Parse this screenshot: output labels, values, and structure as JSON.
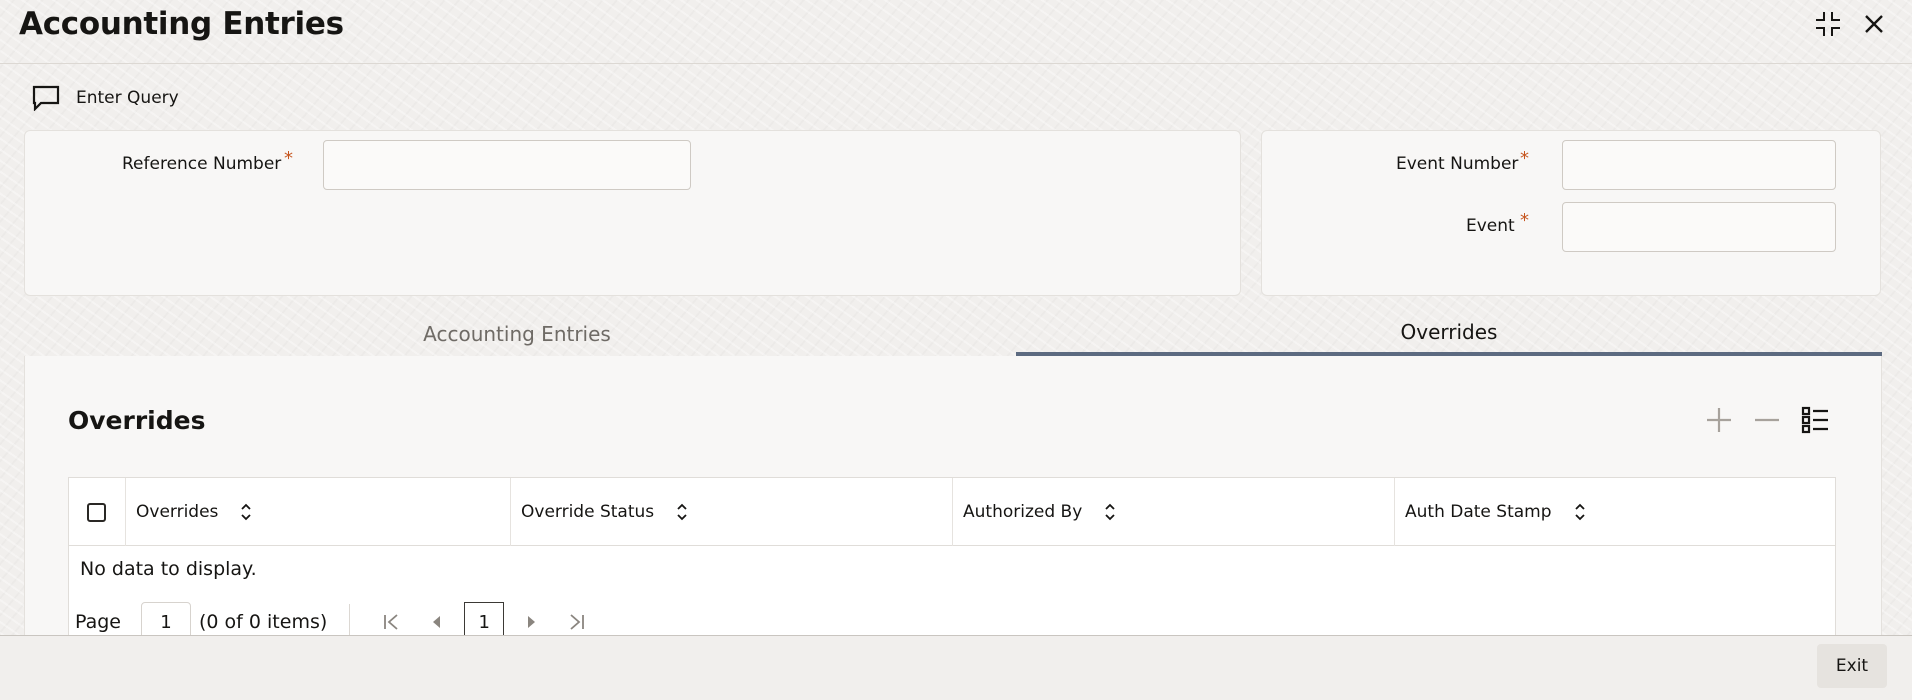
{
  "window": {
    "title": "Accounting Entries"
  },
  "toolbar": {
    "enter_query_label": "Enter Query"
  },
  "form": {
    "reference_number_label": "Reference Number",
    "reference_number_value": "",
    "event_number_label": "Event Number",
    "event_number_value": "",
    "event_label": "Event",
    "event_value": "",
    "required_marker": "*"
  },
  "tabs": [
    {
      "label": "Accounting Entries",
      "active": false
    },
    {
      "label": "Overrides",
      "active": true
    }
  ],
  "overrides": {
    "section_title": "Overrides",
    "columns": [
      "Overrides",
      "Override Status",
      "Authorized By",
      "Auth Date Stamp"
    ],
    "empty_text": "No data to display.",
    "pager": {
      "page_label": "Page",
      "page_input_value": "1",
      "items_text": "(0 of 0 items)",
      "current_page": "1"
    }
  },
  "footer": {
    "exit_label": "Exit"
  },
  "colors": {
    "accent": "#5c6a80",
    "required": "#c6551e",
    "background": "#f1efed"
  },
  "icons": {
    "maximize": "collapse-arrows-icon",
    "close": "close-icon",
    "enter_query": "chat-bubble-icon",
    "add": "plus-icon",
    "remove": "minus-icon",
    "columns": "list-settings-icon",
    "sort": "sort-icon"
  }
}
